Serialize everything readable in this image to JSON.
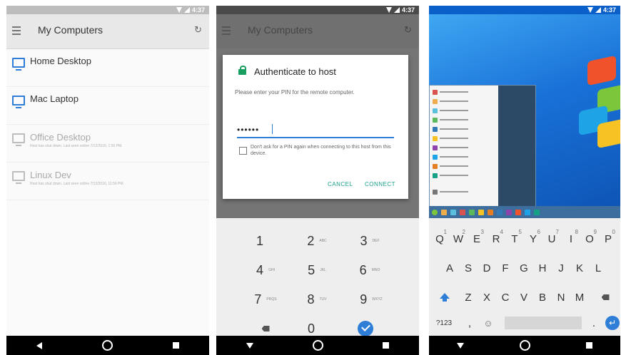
{
  "status": {
    "time": "4:37"
  },
  "computers": {
    "title": "My Computers",
    "items": [
      {
        "name": "Home Desktop",
        "subtitle": "",
        "online": true
      },
      {
        "name": "Mac Laptop",
        "subtitle": "",
        "online": true
      },
      {
        "name": "Office Desktop",
        "subtitle": "Host has shut down. Last seen online 7/12/2016, 1:50 PM.",
        "online": false
      },
      {
        "name": "Linux Dev",
        "subtitle": "Host has shut down. Last seen online 7/12/2016, 11:56 PM.",
        "online": false
      }
    ]
  },
  "auth": {
    "title": "Authenticate to host",
    "message": "Please enter your PIN for the remote computer.",
    "pin_value": "••••••",
    "checkbox_label": "Don't ask for a PIN again when connecting to this host from this device.",
    "cancel": "CANCEL",
    "connect": "CONNECT"
  },
  "numpad": {
    "keys": [
      {
        "digit": "1",
        "letters": ""
      },
      {
        "digit": "2",
        "letters": "ABC"
      },
      {
        "digit": "3",
        "letters": "DEF"
      },
      {
        "digit": "4",
        "letters": "GHI"
      },
      {
        "digit": "5",
        "letters": "JKL"
      },
      {
        "digit": "6",
        "letters": "MNO"
      },
      {
        "digit": "7",
        "letters": "PRQS"
      },
      {
        "digit": "8",
        "letters": "TUV"
      },
      {
        "digit": "9",
        "letters": "WXYZ"
      },
      {
        "digit": "0",
        "letters": ""
      }
    ]
  },
  "keyboard": {
    "row1": [
      {
        "key": "Q",
        "alt": "1"
      },
      {
        "key": "W",
        "alt": "2"
      },
      {
        "key": "E",
        "alt": "3"
      },
      {
        "key": "R",
        "alt": "4"
      },
      {
        "key": "T",
        "alt": "5"
      },
      {
        "key": "Y",
        "alt": "6"
      },
      {
        "key": "U",
        "alt": "7"
      },
      {
        "key": "I",
        "alt": "8"
      },
      {
        "key": "O",
        "alt": "9"
      },
      {
        "key": "P",
        "alt": "0"
      }
    ],
    "row2": [
      "A",
      "S",
      "D",
      "F",
      "G",
      "H",
      "J",
      "K",
      "L"
    ],
    "row3": [
      "Z",
      "X",
      "C",
      "V",
      "B",
      "N",
      "M"
    ],
    "symbols_key": "?123",
    "comma_key": ",",
    "period_key": "."
  },
  "colors": {
    "accent_blue": "#2e7dd7",
    "dialog_green": "#189e5e"
  }
}
